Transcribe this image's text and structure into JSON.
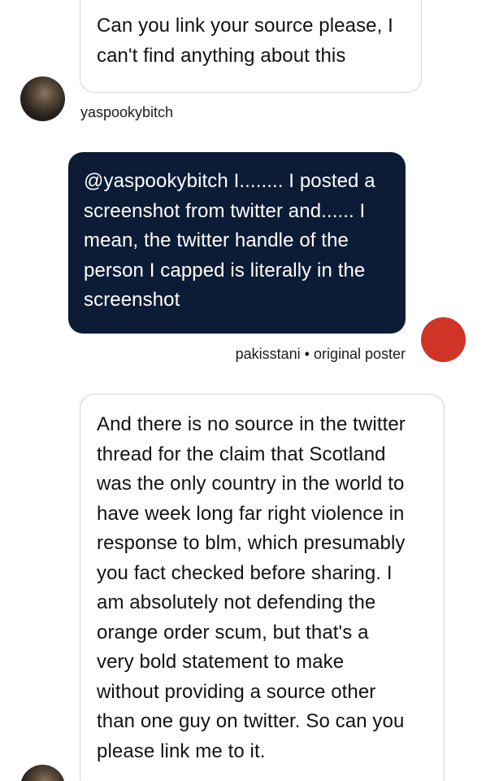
{
  "thread": {
    "messages": [
      {
        "text": "Can you link your source please, I\ncan't find anything about this",
        "style": "light"
      },
      {
        "username": "yaspookybitch",
        "text": "@yaspookybitch I........ I posted a\nscreenshot from twitter and...... I\nmean, the twitter handle of the\nperson I capped is literally in the\nscreenshot",
        "style": "dark"
      },
      {
        "username": "pakisstani",
        "separator": "•",
        "badge": "original poster",
        "text": "And there is no source in the twitter\nthread  for the claim that Scotland\nwas the only country in the world to\nhave week long far right violence in\nresponse to blm, which presumably\nyou fact checked before sharing. I\nam absolutely not defending the\norange order scum, but that's a\nvery bold statement to make\nwithout providing a source other\nthan one guy on twitter. So can you\nplease link me to it.",
        "style": "light"
      }
    ]
  },
  "colors": {
    "dark_bubble": "#0c1c36",
    "light_bubble_border": "#d4d4d4",
    "op_avatar": "#d03427",
    "text": "#121212"
  }
}
